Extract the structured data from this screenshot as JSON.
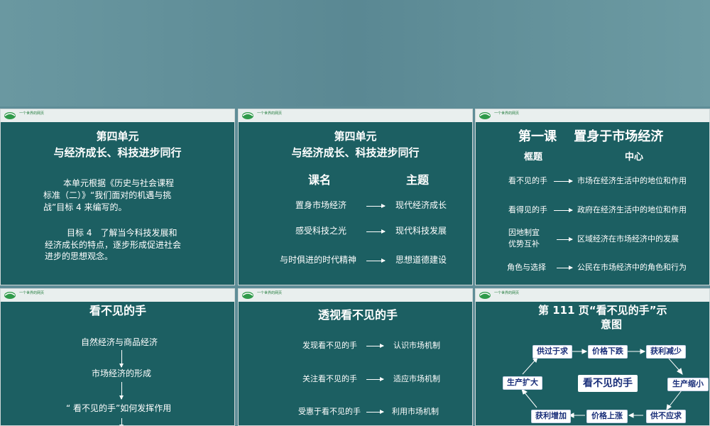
{
  "header": {
    "logo_text": "一个世界的网页"
  },
  "slide1": {
    "title_line1": "第四单元",
    "title_line2": "与经济成长、科技进步同行",
    "para1_line1": "本单元根据《历史与社会课程",
    "para1_line2": "标准（二）》“我们面对的机遇与挑",
    "para1_line3": "战”目标 4 来编写的。",
    "para2_line1": "目标 4　了解当今科技发展和",
    "para2_line2": "经济成长的特点，逐步形成促进社会",
    "para2_line3": "进步的思想观念。"
  },
  "slide2": {
    "title_line1": "第四单元",
    "title_line2": "与经济成长、科技进步同行",
    "col1_header": "课名",
    "col2_header": "主题",
    "rows": [
      {
        "lesson": "置身市场经济",
        "theme": "现代经济成长"
      },
      {
        "lesson": "感受科技之光",
        "theme": "现代科技发展"
      },
      {
        "lesson": "与时俱进的时代精神",
        "theme": "思想道德建设"
      }
    ]
  },
  "slide3": {
    "title": "第一课　 置身于市场经济",
    "col1_header": "框题",
    "col2_header": "中心",
    "rows": [
      {
        "frame": "看不见的手",
        "center": "市场在经济生活中的地位和作用"
      },
      {
        "frame": "看得见的手",
        "center": "政府在经济生活中的地位和作用"
      },
      {
        "frame_line1": "因地制宜",
        "frame_line2": "优势互补",
        "center": "区域经济在市场经济中的发展"
      },
      {
        "frame": "角色与选择",
        "center": "公民在市场经济中的角色和行为"
      }
    ]
  },
  "slide4": {
    "title": "看不见的手",
    "steps": [
      "自然经济与商品经济",
      "市场经济的形成",
      "“ 看不见的手”如何发挥作用"
    ]
  },
  "slide5": {
    "title": "透视看不见的手",
    "rows": [
      {
        "left": "发现看不见的手",
        "right": "认识市场机制"
      },
      {
        "left": "关注看不见的手",
        "right": "适应市场机制"
      },
      {
        "left": "受惠于看不见的手",
        "right": "利用市场机制"
      }
    ]
  },
  "slide6": {
    "title_line1": "第 111 页“看不见的手”示",
    "title_line2": "意图",
    "center": "看不见的手",
    "cycle": {
      "supply_short": "供过于求",
      "price_down": "价格下跌",
      "profit_down": "获利减少",
      "production_shrink": "生产缩小",
      "supply_insufficient": "供不应求",
      "price_up": "价格上涨",
      "profit_up": "获利增加",
      "production_expand": "生产扩大"
    }
  }
}
